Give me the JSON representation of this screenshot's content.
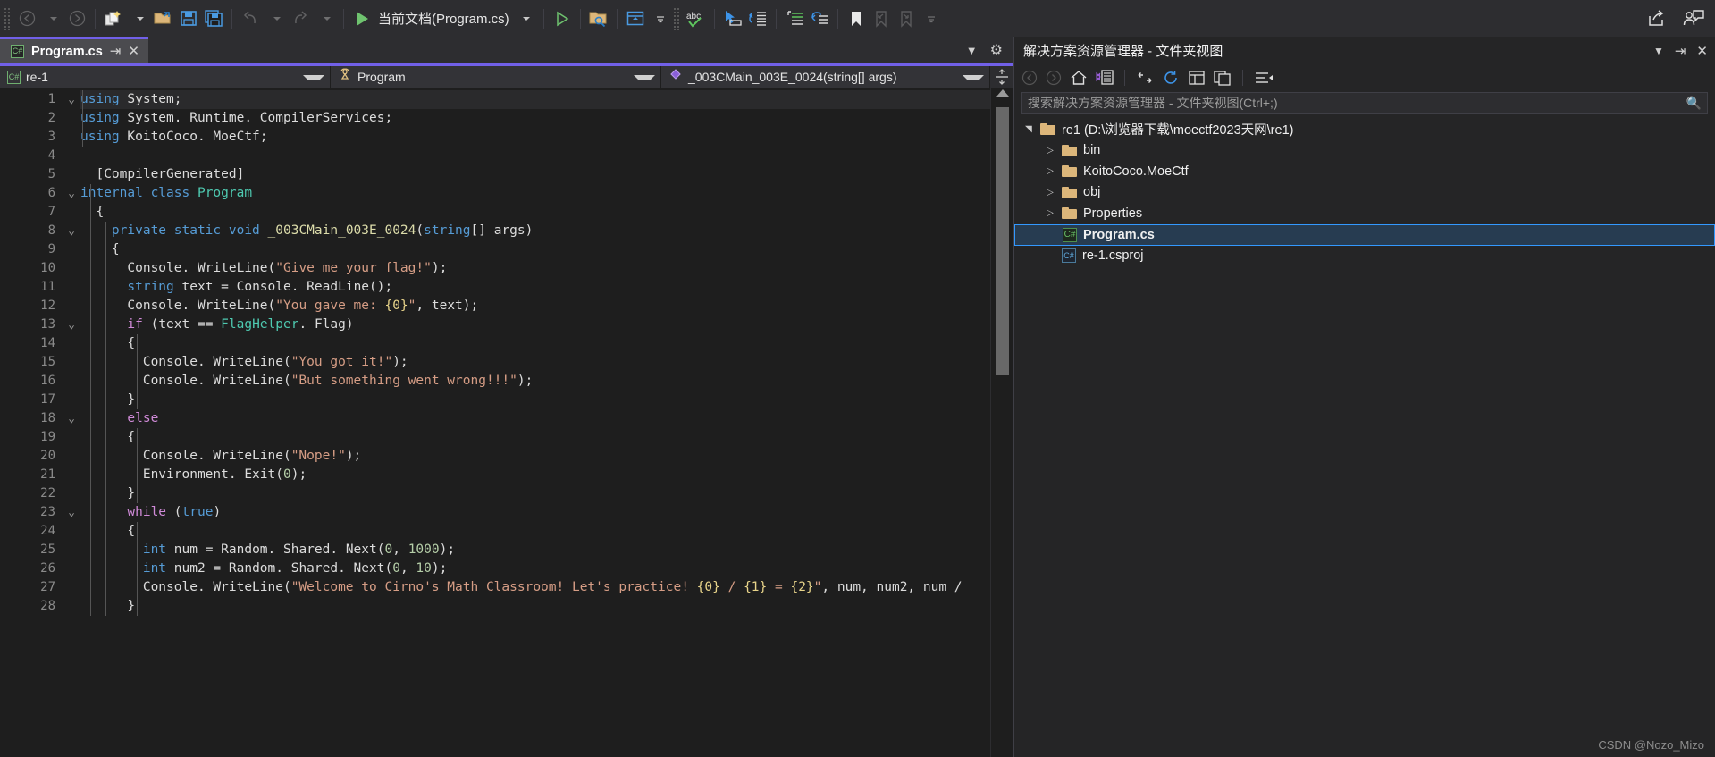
{
  "toolbar": {
    "back_label": "back-navigate",
    "forward_label": "forward-navigate",
    "new_item_label": "new-item",
    "open_label": "open-file",
    "save_label": "save",
    "save_all_label": "save-all",
    "undo_label": "undo",
    "redo_label": "redo",
    "run_label": "当前文档(Program.cs)",
    "run_no_debug_label": "start-without-debugging",
    "find_label": "find-in-files",
    "window_label": "window-layout",
    "spell_label": "abc",
    "cursor_label": "select-mode",
    "indent_label": "indent",
    "comment_label": "comment",
    "uncomment_label": "uncomment",
    "bookmark_label": "bookmark",
    "bookmark_prev_label": "previous-bookmark",
    "bookmark_next_label": "next-bookmark",
    "share_label": "share",
    "feedback_label": "send-feedback"
  },
  "tab": {
    "name": "Program.cs",
    "icon": "csharp-file-icon",
    "pin": "pin-icon",
    "close": "close-icon",
    "accent_color": "#7160e8"
  },
  "navbar": {
    "project": "re-1",
    "type": "Program",
    "member": "_003CMain_003E_0024(string[] args)"
  },
  "editor": {
    "lines": [
      {
        "n": 1,
        "fold": "v",
        "hl": true,
        "tokens": [
          {
            "t": "using",
            "c": "k"
          },
          {
            "t": " System;",
            "c": "pl"
          }
        ]
      },
      {
        "n": 2,
        "fold": "",
        "tokens": [
          {
            "t": "using",
            "c": "k"
          },
          {
            "t": " System. Runtime. CompilerServices;",
            "c": "pl"
          }
        ]
      },
      {
        "n": 3,
        "fold": "",
        "tokens": [
          {
            "t": "using",
            "c": "k"
          },
          {
            "t": " KoitoCoco. MoeCtf;",
            "c": "pl"
          }
        ]
      },
      {
        "n": 4,
        "fold": "",
        "tokens": []
      },
      {
        "n": 5,
        "fold": "",
        "tokens": [
          {
            "t": "  [CompilerGenerated]",
            "c": "at"
          }
        ]
      },
      {
        "n": 6,
        "fold": "v",
        "tokens": [
          {
            "t": "internal",
            "c": "k"
          },
          {
            "t": " ",
            "c": "pl"
          },
          {
            "t": "class",
            "c": "k"
          },
          {
            "t": " ",
            "c": "pl"
          },
          {
            "t": "Program",
            "c": "ty"
          }
        ]
      },
      {
        "n": 7,
        "fold": "",
        "tokens": [
          {
            "t": "  {",
            "c": "pl"
          }
        ]
      },
      {
        "n": 8,
        "fold": "v",
        "tokens": [
          {
            "t": "    ",
            "c": "pl"
          },
          {
            "t": "private static void",
            "c": "k"
          },
          {
            "t": " ",
            "c": "pl"
          },
          {
            "t": "_003CMain_003E_0024",
            "c": "me"
          },
          {
            "t": "(",
            "c": "pl"
          },
          {
            "t": "string",
            "c": "k"
          },
          {
            "t": "[] args)",
            "c": "pl"
          }
        ]
      },
      {
        "n": 9,
        "fold": "",
        "tokens": [
          {
            "t": "    {",
            "c": "pl"
          }
        ]
      },
      {
        "n": 10,
        "fold": "",
        "tokens": [
          {
            "t": "      Console. WriteLine(",
            "c": "pl"
          },
          {
            "t": "\"Give me your flag!\"",
            "c": "st"
          },
          {
            "t": ");",
            "c": "pl"
          }
        ]
      },
      {
        "n": 11,
        "fold": "",
        "tokens": [
          {
            "t": "      ",
            "c": "pl"
          },
          {
            "t": "string",
            "c": "k"
          },
          {
            "t": " text = Console. ReadLine();",
            "c": "pl"
          }
        ]
      },
      {
        "n": 12,
        "fold": "",
        "tokens": [
          {
            "t": "      Console. WriteLine(",
            "c": "pl"
          },
          {
            "t": "\"You gave me: ",
            "c": "st"
          },
          {
            "t": "{0}",
            "c": "fmt"
          },
          {
            "t": "\"",
            "c": "st"
          },
          {
            "t": ", text);",
            "c": "pl"
          }
        ]
      },
      {
        "n": 13,
        "fold": "v",
        "tokens": [
          {
            "t": "      ",
            "c": "pl"
          },
          {
            "t": "if",
            "c": "kc"
          },
          {
            "t": " (text == ",
            "c": "pl"
          },
          {
            "t": "FlagHelper",
            "c": "ty"
          },
          {
            "t": ". Flag)",
            "c": "pl"
          }
        ]
      },
      {
        "n": 14,
        "fold": "",
        "tokens": [
          {
            "t": "      {",
            "c": "pl"
          }
        ]
      },
      {
        "n": 15,
        "fold": "",
        "tokens": [
          {
            "t": "        Console. WriteLine(",
            "c": "pl"
          },
          {
            "t": "\"You got it!\"",
            "c": "st"
          },
          {
            "t": ");",
            "c": "pl"
          }
        ]
      },
      {
        "n": 16,
        "fold": "",
        "tokens": [
          {
            "t": "        Console. WriteLine(",
            "c": "pl"
          },
          {
            "t": "\"But something went wrong!!!\"",
            "c": "st"
          },
          {
            "t": ");",
            "c": "pl"
          }
        ]
      },
      {
        "n": 17,
        "fold": "",
        "tokens": [
          {
            "t": "      }",
            "c": "pl"
          }
        ]
      },
      {
        "n": 18,
        "fold": "v",
        "tokens": [
          {
            "t": "      ",
            "c": "pl"
          },
          {
            "t": "else",
            "c": "kc"
          }
        ]
      },
      {
        "n": 19,
        "fold": "",
        "tokens": [
          {
            "t": "      {",
            "c": "pl"
          }
        ]
      },
      {
        "n": 20,
        "fold": "",
        "tokens": [
          {
            "t": "        Console. WriteLine(",
            "c": "pl"
          },
          {
            "t": "\"Nope!\"",
            "c": "st"
          },
          {
            "t": ");",
            "c": "pl"
          }
        ]
      },
      {
        "n": 21,
        "fold": "",
        "tokens": [
          {
            "t": "        Environment. Exit(",
            "c": "pl"
          },
          {
            "t": "0",
            "c": "nu"
          },
          {
            "t": ");",
            "c": "pl"
          }
        ]
      },
      {
        "n": 22,
        "fold": "",
        "tokens": [
          {
            "t": "      }",
            "c": "pl"
          }
        ]
      },
      {
        "n": 23,
        "fold": "v",
        "tokens": [
          {
            "t": "      ",
            "c": "pl"
          },
          {
            "t": "while",
            "c": "kc"
          },
          {
            "t": " (",
            "c": "pl"
          },
          {
            "t": "true",
            "c": "k"
          },
          {
            "t": ")",
            "c": "pl"
          }
        ]
      },
      {
        "n": 24,
        "fold": "",
        "tokens": [
          {
            "t": "      {",
            "c": "pl"
          }
        ]
      },
      {
        "n": 25,
        "fold": "",
        "tokens": [
          {
            "t": "        ",
            "c": "pl"
          },
          {
            "t": "int",
            "c": "k"
          },
          {
            "t": " num = Random. Shared. Next(",
            "c": "pl"
          },
          {
            "t": "0",
            "c": "nu"
          },
          {
            "t": ", ",
            "c": "pl"
          },
          {
            "t": "1000",
            "c": "nu"
          },
          {
            "t": ");",
            "c": "pl"
          }
        ]
      },
      {
        "n": 26,
        "fold": "",
        "tokens": [
          {
            "t": "        ",
            "c": "pl"
          },
          {
            "t": "int",
            "c": "k"
          },
          {
            "t": " num2 = Random. Shared. Next(",
            "c": "pl"
          },
          {
            "t": "0",
            "c": "nu"
          },
          {
            "t": ", ",
            "c": "pl"
          },
          {
            "t": "10",
            "c": "nu"
          },
          {
            "t": ");",
            "c": "pl"
          }
        ]
      },
      {
        "n": 27,
        "fold": "",
        "tokens": [
          {
            "t": "        Console. WriteLine(",
            "c": "pl"
          },
          {
            "t": "\"Welcome to Cirno's Math Classroom! Let's practice! ",
            "c": "st"
          },
          {
            "t": "{0}",
            "c": "fmt"
          },
          {
            "t": " / ",
            "c": "st"
          },
          {
            "t": "{1}",
            "c": "fmt"
          },
          {
            "t": " = ",
            "c": "st"
          },
          {
            "t": "{2}",
            "c": "fmt"
          },
          {
            "t": "\"",
            "c": "st"
          },
          {
            "t": ", num, num2, num /",
            "c": "pl"
          }
        ]
      },
      {
        "n": 28,
        "fold": "",
        "tokens": [
          {
            "t": "      }",
            "c": "pl"
          }
        ]
      }
    ]
  },
  "solution": {
    "title": "解决方案资源管理器 - 文件夹视图",
    "toolbar": {
      "back": "back-icon",
      "forward": "forward-icon",
      "home": "home-icon",
      "switch_views": "switch-views-icon",
      "collapse": "collapse-all-icon",
      "refresh": "refresh-icon",
      "show_all": "show-all-files-icon",
      "properties": "properties-icon",
      "filter": "filter-icon"
    },
    "search_placeholder": "搜索解决方案资源管理器 - 文件夹视图(Ctrl+;)",
    "search_value": "",
    "search_icon": "search-icon",
    "minimize": "chevron-down-icon",
    "pin": "pin-icon",
    "close": "close-icon",
    "tree": [
      {
        "label": "re1 (D:\\浏览器下载\\moectf2023天网\\re1)",
        "icon": "folder",
        "indent": 0,
        "twisty": "expanded",
        "selected": false,
        "bold": false
      },
      {
        "label": "bin",
        "icon": "folder",
        "indent": 1,
        "twisty": "collapsed",
        "selected": false,
        "bold": false
      },
      {
        "label": "KoitoCoco.MoeCtf",
        "icon": "folder",
        "indent": 1,
        "twisty": "collapsed",
        "selected": false,
        "bold": false
      },
      {
        "label": "obj",
        "icon": "folder",
        "indent": 1,
        "twisty": "collapsed",
        "selected": false,
        "bold": false
      },
      {
        "label": "Properties",
        "icon": "folder",
        "indent": 1,
        "twisty": "collapsed",
        "selected": false,
        "bold": false
      },
      {
        "label": "Program.cs",
        "icon": "csharp",
        "indent": 1,
        "twisty": "none",
        "selected": true,
        "bold": true
      },
      {
        "label": "re-1.csproj",
        "icon": "csproj",
        "indent": 1,
        "twisty": "none",
        "selected": false,
        "bold": false
      }
    ]
  },
  "watermark": "CSDN @Nozo_Mizo"
}
